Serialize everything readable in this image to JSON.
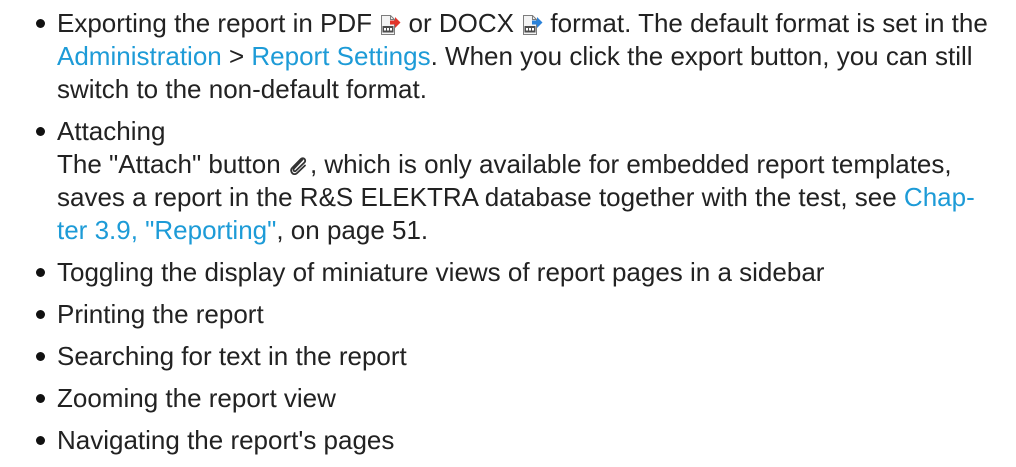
{
  "colors": {
    "text": "#222222",
    "link": "#1d9bd7",
    "bullet": "#111111"
  },
  "items": [
    {
      "lines": [
        [
          {
            "text": "Exporting the report in PDF "
          },
          {
            "icon": "pdf-export-icon"
          },
          {
            "text": " or DOCX "
          },
          {
            "icon": "docx-export-icon"
          },
          {
            "text": " format. The default format is set in the"
          }
        ],
        [
          {
            "text": "Administration",
            "link": true
          },
          {
            "text": " > "
          },
          {
            "text": "Report Settings",
            "link": true
          },
          {
            "text": ". When you click the export button, you can still"
          }
        ],
        [
          {
            "text": "switch to the non-default format."
          }
        ]
      ]
    },
    {
      "lines": [
        [
          {
            "text": "Attaching"
          }
        ],
        [
          {
            "text": "The \"Attach\" button "
          },
          {
            "icon": "paperclip-icon"
          },
          {
            "text": ", which is only available for embedded report templates,"
          }
        ],
        [
          {
            "text": "saves a report in the R&S ELEKTRA database together with the test, see "
          },
          {
            "text": "Chap-",
            "link": true
          }
        ],
        [
          {
            "text": "ter 3.9, \"Reporting\"",
            "link": true
          },
          {
            "text": ", on page 51."
          }
        ]
      ]
    },
    {
      "lines": [
        [
          {
            "text": "Toggling the display of miniature views of report pages in a sidebar"
          }
        ]
      ]
    },
    {
      "lines": [
        [
          {
            "text": "Printing the report"
          }
        ]
      ]
    },
    {
      "lines": [
        [
          {
            "text": "Searching for text in the report"
          }
        ]
      ]
    },
    {
      "lines": [
        [
          {
            "text": "Zooming the report view"
          }
        ]
      ]
    },
    {
      "lines": [
        [
          {
            "text": "Navigating the report's pages"
          }
        ]
      ]
    }
  ]
}
